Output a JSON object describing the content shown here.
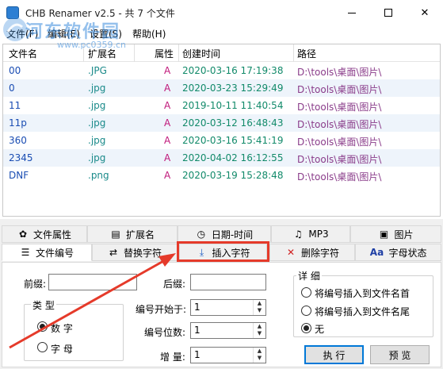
{
  "window": {
    "title": "CHB Renamer v2.5 - 共 7 个文件",
    "minimize": "—",
    "close": "✕"
  },
  "menu": [
    "文件(F)",
    "编辑(E)",
    "设置(S)",
    "帮助(H)"
  ],
  "columns": [
    "文件名",
    "扩展名",
    "属性",
    "创建时间",
    "路径"
  ],
  "rows": [
    {
      "name": "00",
      "ext": ".JPG",
      "attr": "A",
      "time": "2020-03-16 17:19:38",
      "path": "D:\\tools\\桌面\\图片\\"
    },
    {
      "name": "0",
      "ext": ".jpg",
      "attr": "A",
      "time": "2020-03-23 15:29:49",
      "path": "D:\\tools\\桌面\\图片\\"
    },
    {
      "name": "11",
      "ext": ".jpg",
      "attr": "A",
      "time": "2019-10-11 11:40:54",
      "path": "D:\\tools\\桌面\\图片\\"
    },
    {
      "name": "11p",
      "ext": ".jpg",
      "attr": "A",
      "time": "2020-03-12 16:48:43",
      "path": "D:\\tools\\桌面\\图片\\"
    },
    {
      "name": "360",
      "ext": ".jpg",
      "attr": "A",
      "time": "2020-03-16 15:41:19",
      "path": "D:\\tools\\桌面\\图片\\"
    },
    {
      "name": "2345",
      "ext": ".jpg",
      "attr": "A",
      "time": "2020-04-02 16:12:55",
      "path": "D:\\tools\\桌面\\图片\\"
    },
    {
      "name": "DNF",
      "ext": ".png",
      "attr": "A",
      "time": "2020-03-19 15:28:48",
      "path": "D:\\tools\\桌面\\图片\\"
    }
  ],
  "tabs_top": [
    {
      "label": "文件属性",
      "icon": "gear-icon",
      "glyph": "✿"
    },
    {
      "label": "扩展名",
      "icon": "document-icon",
      "glyph": "▤"
    },
    {
      "label": "日期-时间",
      "icon": "clock-icon",
      "glyph": "◷"
    },
    {
      "label": "MP3",
      "icon": "music-icon",
      "glyph": "♫"
    },
    {
      "label": "图片",
      "icon": "image-icon",
      "glyph": "▣"
    }
  ],
  "tabs_bottom": [
    {
      "label": "文件编号",
      "icon": "list-icon",
      "glyph": "☰"
    },
    {
      "label": "替换字符",
      "icon": "replace-icon",
      "glyph": "⇄"
    },
    {
      "label": "插入字符",
      "icon": "insert-icon",
      "glyph": "⤓"
    },
    {
      "label": "删除字符",
      "icon": "delete-icon",
      "glyph": "✕"
    },
    {
      "label": "字母状态",
      "icon": "letter-case-icon",
      "glyph": "Aa"
    }
  ],
  "form": {
    "prefix_label": "前缀:",
    "suffix_label": "后缀:",
    "type_title": "类 型",
    "type_number": "数 字",
    "type_letter": "字 母",
    "start_label": "编号开始于:",
    "start_value": "1",
    "digits_label": "编号位数:",
    "digits_value": "1",
    "increment_label": "增 量:",
    "increment_value": "1",
    "detail_title": "详 细",
    "opt_head": "将编号插入到文件名首",
    "opt_tail": "将编号插入到文件名尾",
    "opt_none": "无",
    "execute": "执 行",
    "preview": "预 览"
  },
  "watermark": {
    "text": "河东软件园",
    "url": "www.pc0359.cn"
  },
  "colors": {
    "highlight": "#e53a2a",
    "name": "#1a4db3",
    "attr": "#c0177a"
  }
}
